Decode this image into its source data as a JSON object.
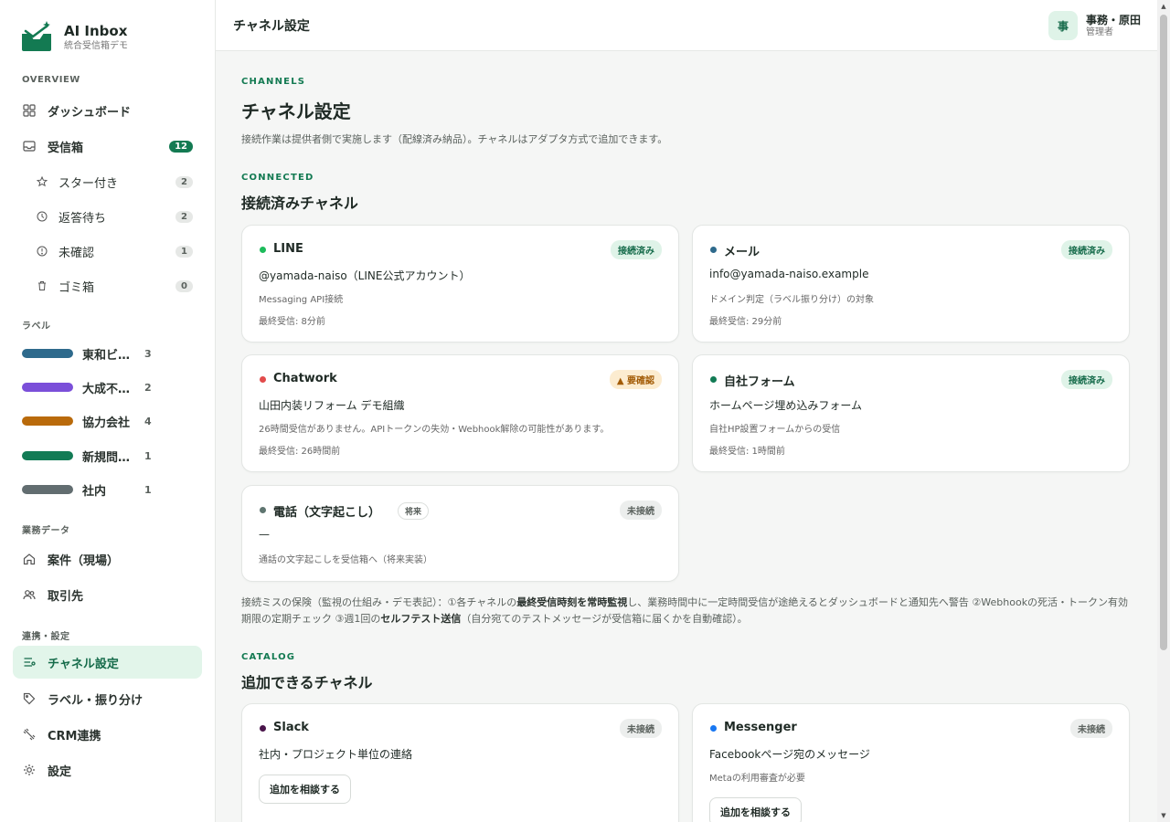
{
  "brand": {
    "title": "AI Inbox",
    "subtitle": "統合受信箱デモ"
  },
  "sidebar": {
    "overview_label": "OVERVIEW",
    "dashboard": "ダッシュボード",
    "inbox": {
      "label": "受信箱",
      "count": "12"
    },
    "starred": {
      "label": "スター付き",
      "count": "2"
    },
    "awaiting": {
      "label": "返答待ち",
      "count": "2"
    },
    "unconfirmed": {
      "label": "未確認",
      "count": "1"
    },
    "trash": {
      "label": "ゴミ箱",
      "count": "0"
    },
    "labels_label": "ラベル",
    "labels": [
      {
        "name": "東和ビ…",
        "count": "3",
        "color": "#2e6a8c"
      },
      {
        "name": "大成不…",
        "count": "2",
        "color": "#7b4fd9"
      },
      {
        "name": "協力会社",
        "count": "4",
        "color": "#b96a0b"
      },
      {
        "name": "新規問…",
        "count": "1",
        "color": "#127b55"
      },
      {
        "name": "社内",
        "count": "1",
        "color": "#626d70"
      }
    ],
    "business_label": "業務データ",
    "projects": "案件（現場）",
    "clients": "取引先",
    "integration_label": "連携・設定",
    "channel_settings": "チャネル設定",
    "labels_routing": "ラベル・振り分け",
    "crm": "CRM連携",
    "settings": "設定"
  },
  "header": {
    "title": "チャネル設定",
    "user": {
      "initial": "事",
      "name": "事務・原田",
      "role": "管理者"
    }
  },
  "page": {
    "eyebrow": "CHANNELS",
    "title": "チャネル設定",
    "description": "接続作業は提供者側で実施します（配線済み納品）。チャネルはアダプタ方式で追加できます。",
    "connected_eyebrow": "CONNECTED",
    "connected_title": "接続済みチャネル",
    "catalog_eyebrow": "CATALOG",
    "catalog_title": "追加できるチャネル"
  },
  "channels": [
    {
      "name": "LINE",
      "status": "接続済み",
      "account": "@yamada-naiso（LINE公式アカウント）",
      "detail": "Messaging API接続",
      "last": "最終受信: 8分前",
      "dot": "#1dbb5b"
    },
    {
      "name": "メール",
      "status": "接続済み",
      "account": "info@yamada-naiso.example",
      "detail": "ドメイン判定（ラベル振り分け）の対象",
      "last": "最終受信: 29分前",
      "dot": "#2e6a8c"
    },
    {
      "name": "Chatwork",
      "status": "▲ 要確認",
      "account": "山田内装リフォーム デモ組織",
      "detail": "26時間受信がありません。APIトークンの失効・Webhook解除の可能性があります。",
      "last": "最終受信: 26時間前",
      "dot": "#e24b4b"
    },
    {
      "name": "自社フォーム",
      "status": "接続済み",
      "account": "ホームページ埋め込みフォーム",
      "detail": "自社HP設置フォームからの受信",
      "last": "最終受信: 1時間前",
      "dot": "#127b55"
    },
    {
      "name": "電話（文字起こし）",
      "tag": "将来",
      "status": "未接続",
      "account": "—",
      "detail": "通話の文字起こしを受信箱へ（将来実装）",
      "dot": "#5f7570"
    }
  ],
  "note": {
    "p1": "接続ミスの保険（監視の仕組み・デモ表記）：①各チャネルの",
    "b1": "最終受信時刻を常時監視",
    "p2": "し、業務時間中に一定時間受信が途絶えるとダッシュボードと通知先へ警告 ②Webhookの死活・トークン有効期限の定期チェック ③週1回の",
    "b2": "セルフテスト送信",
    "p3": "（自分宛てのテストメッセージが受信箱に届くかを自動確認）。"
  },
  "catalog": [
    {
      "name": "Slack",
      "status": "未接続",
      "desc": "社内・プロジェクト単位の連絡",
      "button": "追加を相談する",
      "dot": "#4a154b"
    },
    {
      "name": "Messenger",
      "status": "未接続",
      "desc": "Facebookページ宛のメッセージ",
      "detail": "Metaの利用審査が必要",
      "button": "追加を相談する",
      "dot": "#1877f2"
    }
  ]
}
